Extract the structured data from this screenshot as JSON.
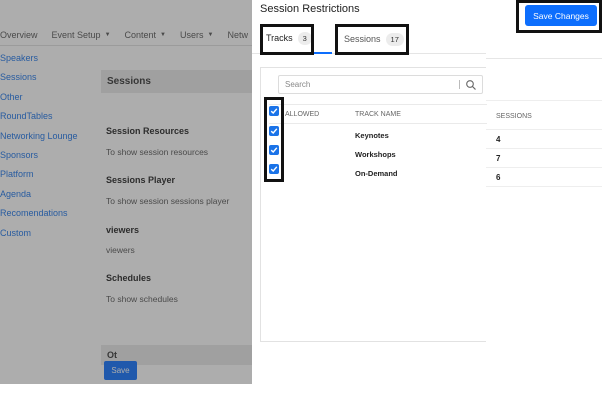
{
  "nav": {
    "items": [
      {
        "label": "Overview",
        "caret": false
      },
      {
        "label": "Event Setup",
        "caret": true
      },
      {
        "label": "Content",
        "caret": true
      },
      {
        "label": "Users",
        "caret": true
      },
      {
        "label": "Netw",
        "caret": false
      }
    ]
  },
  "sidebar": {
    "items": [
      "Speakers",
      "Sessions",
      "Other",
      "RoundTables",
      "Networking Lounge",
      "Sponsors",
      "Platform",
      "Agenda",
      "Recomendations",
      "Custom"
    ]
  },
  "main": {
    "section_title": "Sessions",
    "groups": [
      {
        "title": "Session Resources",
        "desc": "To show session resources"
      },
      {
        "title": "Sessions Player",
        "desc": "To show session sessions player"
      },
      {
        "title": "viewers",
        "desc": "viewers"
      },
      {
        "title": "Schedules",
        "desc": "To show schedules"
      }
    ],
    "other_title": "Ot",
    "save_label": "Save"
  },
  "drawer": {
    "title": "Session Restrictions",
    "save_changes_label": "Save Changes",
    "tabs": [
      {
        "label": "Tracks",
        "count": "3"
      },
      {
        "label": "Sessions",
        "count": "17"
      }
    ],
    "search_placeholder": "Search",
    "columns": {
      "allowed": "ALLOWED",
      "track_name": "TRACK NAME"
    },
    "tracks": [
      {
        "name": "Keynotes",
        "allowed": true
      },
      {
        "name": "Workshops",
        "allowed": true
      },
      {
        "name": "On-Demand",
        "allowed": true
      }
    ]
  },
  "right_panel": {
    "column": "SESSIONS",
    "values": [
      "4",
      "7",
      "6"
    ]
  },
  "colors": {
    "accent": "#0d6efd",
    "link": "#1a73e8",
    "highlight": "#111111"
  }
}
